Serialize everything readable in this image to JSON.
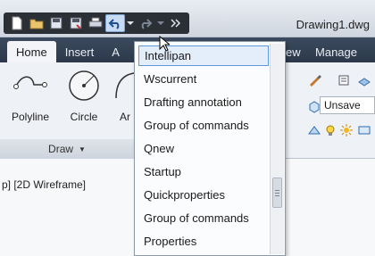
{
  "title_bar": {
    "document_title": "Drawing1.dwg"
  },
  "quick_access": {
    "icons": [
      "new-icon",
      "open-icon",
      "save-icon",
      "save-as-icon",
      "print-icon",
      "undo-icon",
      "dropdown-icon",
      "redo-icon",
      "more-icon"
    ]
  },
  "ribbon_tabs": {
    "home": "Home",
    "insert": "Insert",
    "annotate_partial": "A",
    "view_partial": "ew",
    "manage": "Manage"
  },
  "draw_panel": {
    "polyline": "Polyline",
    "circle": "Circle",
    "arc_partial": "Ar",
    "label": "Draw"
  },
  "layer_panel": {
    "layer_state": "Unsave"
  },
  "viewport": {
    "label": "p] [2D Wireframe]"
  },
  "undo_menu": {
    "items": [
      {
        "label": "Intellipan"
      },
      {
        "label": "Wscurrent"
      },
      {
        "label": "Drafting  annotation"
      },
      {
        "label": "Group of commands"
      },
      {
        "label": "Qnew"
      },
      {
        "label": "Startup"
      },
      {
        "label": "Quickproperties"
      },
      {
        "label": "Group of commands"
      },
      {
        "label": "Properties"
      }
    ],
    "highlighted_index": 0
  },
  "colors": {
    "tab_bar": "#2c394b",
    "menu_highlight": "#e4eefb",
    "menu_highlight_border": "#5f97d8"
  }
}
